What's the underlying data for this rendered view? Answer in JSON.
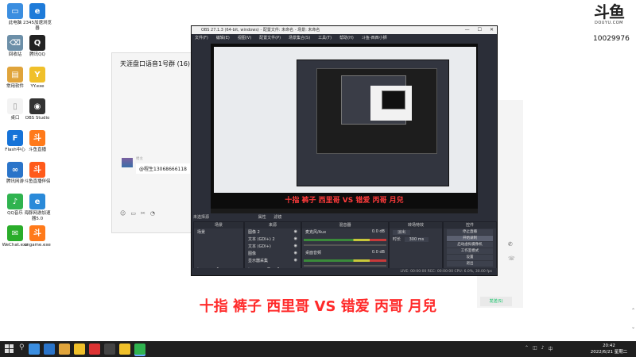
{
  "desktop_icons": [
    {
      "label": "此电脑",
      "color": "#3b8ee0",
      "glyph": "▭"
    },
    {
      "label": "2345加速浏览器",
      "color": "#1e7bd9",
      "glyph": "e"
    },
    {
      "label": "回收站",
      "color": "#6c8fa8",
      "glyph": "⌫"
    },
    {
      "label": "腾讯QQ",
      "color": "#222222",
      "glyph": "Q"
    },
    {
      "label": "常用软件",
      "color": "#e0a43b",
      "glyph": "▤"
    },
    {
      "label": "YY.exe",
      "color": "#f0c02a",
      "glyph": "Y"
    },
    {
      "label": "桌口",
      "color": "#f3f3f3",
      "glyph": "▯"
    },
    {
      "label": "OBS Studio",
      "color": "#333333",
      "glyph": "◉"
    },
    {
      "label": "Flash中心",
      "color": "#1673d8",
      "glyph": "F"
    },
    {
      "label": "斗鱼直播",
      "color": "#ff7a1a",
      "glyph": "斗"
    },
    {
      "label": "腾讯网游",
      "color": "#2a74c9",
      "glyph": "∞"
    },
    {
      "label": "斗鱼直播伴侣",
      "color": "#ff5a1a",
      "glyph": "斗"
    },
    {
      "label": "QQ音乐",
      "color": "#2fb34f",
      "glyph": "♪"
    },
    {
      "label": "海豚网游加速器5.0",
      "color": "#2a8ad9",
      "glyph": "e"
    },
    {
      "label": "WeChat.exe",
      "color": "#2aad2a",
      "glyph": "✉"
    },
    {
      "label": "cngame.exe",
      "color": "#ff7a1a",
      "glyph": "斗"
    }
  ],
  "logo": {
    "mark": "斗鱼",
    "url": "DOUYU.COM"
  },
  "room_id": "10029976",
  "chat": {
    "title": "天涯盘口语音1号群 (16)",
    "nick": "楼主",
    "message": "@程生13068666118",
    "send_label": "发送(S)"
  },
  "obs": {
    "title": "OBS 27.1.3 (64-bit, windows) - 配置文件: 未命名 - 场景: 未命名",
    "menu": [
      "文件(F)",
      "编辑(E)",
      "视图(V)",
      "配置文件(P)",
      "场景集合(S)",
      "工具(T)",
      "帮助(H)",
      "斗鱼-西西小狮"
    ],
    "inner_caption": "十指 裤子 西里哥 VS 错爱 丙哥 月兒",
    "tabs_label": "未选择源",
    "tab_props": "属性",
    "tab_filters": "滤镜",
    "docks": {
      "scenes": {
        "header": "场景",
        "items": [
          "场景"
        ]
      },
      "sources": {
        "header": "来源",
        "items": [
          "图像 2",
          "文本 (GDI+) 2",
          "文本 (GDI+)",
          "图像",
          "显示器采集"
        ]
      },
      "mixer": {
        "header": "混音器",
        "channels": [
          {
            "name": "麦克风/Aux",
            "db": "0.0 dB"
          },
          {
            "name": "桌面音频",
            "db": "0.0 dB"
          }
        ]
      },
      "transitions": {
        "header": "转场特效",
        "type": "淡出",
        "duration_label": "时长",
        "duration": "300 ms"
      },
      "controls": {
        "header": "控件",
        "buttons": [
          "停止直播",
          "开始录制",
          "启动虚拟摄像机",
          "工作室模式",
          "设置",
          "退出"
        ]
      }
    },
    "status": "LIVE: 00:00:00   REC: 00:00:00   CPU: 6.0%, 30.00 fps"
  },
  "big_caption": "十指 裤子 西里哥 VS 错爱 丙哥 月兒",
  "taskbar": {
    "time": "20:42",
    "date": "2022/6/21 星期二",
    "apps": [
      "#3b8ee0",
      "#2a74c9",
      "#e0a43b",
      "#f0c02a",
      "#d33",
      "#444",
      "#f0c02a",
      "#2fb34f"
    ]
  }
}
